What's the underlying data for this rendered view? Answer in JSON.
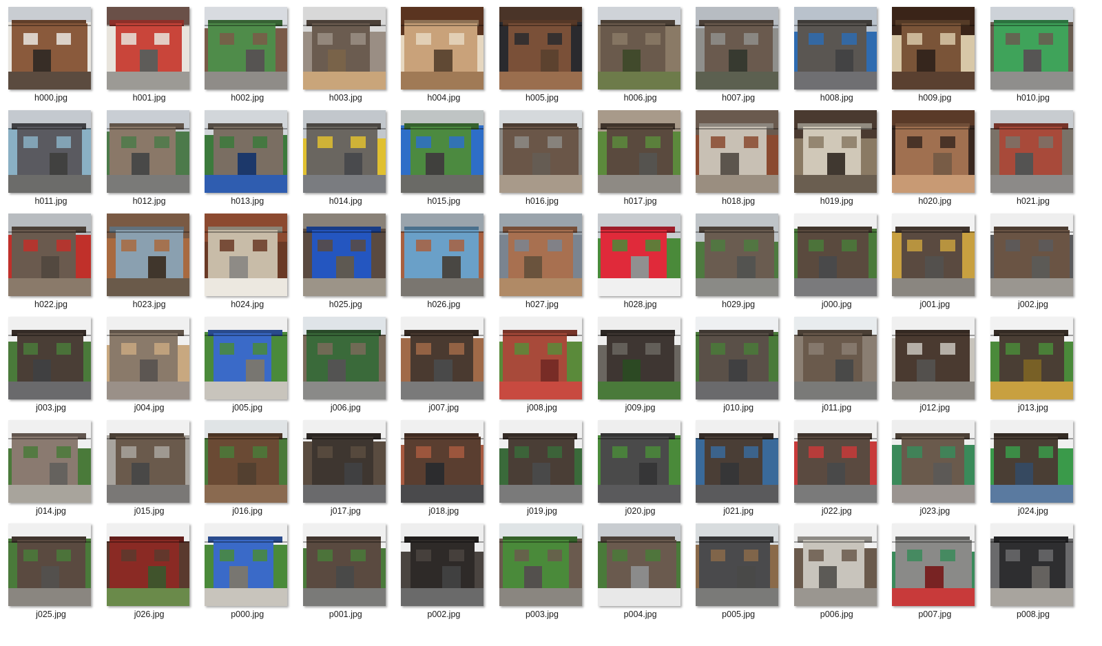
{
  "files": [
    {
      "name": "h000.jpg",
      "palette": [
        "#c9cdd2",
        "#8a5a3c",
        "#e9e6e0",
        "#5b4b3f"
      ]
    },
    {
      "name": "h001.jpg",
      "palette": [
        "#6a5048",
        "#c9453a",
        "#e8e4dc",
        "#9c9a95"
      ]
    },
    {
      "name": "h002.jpg",
      "palette": [
        "#d8dbe0",
        "#4f8c4a",
        "#7a5a48",
        "#8f8c88"
      ]
    },
    {
      "name": "h003.jpg",
      "palette": [
        "#d8d8d8",
        "#6b5c50",
        "#9a8e84",
        "#c9a57a"
      ]
    },
    {
      "name": "h004.jpg",
      "palette": [
        "#5a3420",
        "#c9a27a",
        "#e6d7c0",
        "#a07a56"
      ]
    },
    {
      "name": "h005.jpg",
      "palette": [
        "#4a3428",
        "#7a5038",
        "#2a2a2e",
        "#9a6e4e"
      ]
    },
    {
      "name": "h006.jpg",
      "palette": [
        "#cfd3d8",
        "#6a5a4c",
        "#8a7a66",
        "#6d7b4a"
      ]
    },
    {
      "name": "h007.jpg",
      "palette": [
        "#b7bcc2",
        "#6a5a4e",
        "#8f8f8c",
        "#5c6050"
      ]
    },
    {
      "name": "h008.jpg",
      "palette": [
        "#b9c2cc",
        "#5a5652",
        "#2e6bb0",
        "#6f6f72"
      ]
    },
    {
      "name": "h009.jpg",
      "palette": [
        "#3a2418",
        "#7a5438",
        "#d8c8a8",
        "#5a4030"
      ]
    },
    {
      "name": "h010.jpg",
      "palette": [
        "#cdd2d8",
        "#3fa35a",
        "#6a5c50",
        "#8f8e8c"
      ]
    },
    {
      "name": "h011.jpg",
      "palette": [
        "#c4c9cf",
        "#5a5a60",
        "#8ab0c4",
        "#6c6c6a"
      ]
    },
    {
      "name": "h012.jpg",
      "palette": [
        "#c9ced4",
        "#8a7868",
        "#4c7a4a",
        "#7a7a78"
      ]
    },
    {
      "name": "h013.jpg",
      "palette": [
        "#d2d6da",
        "#7a6e62",
        "#3c7a3c",
        "#2f5db0"
      ]
    },
    {
      "name": "h014.jpg",
      "palette": [
        "#c2c7cc",
        "#6a6660",
        "#e0c030",
        "#7a7c80"
      ]
    },
    {
      "name": "h015.jpg",
      "palette": [
        "#bfc4c4",
        "#4c8a40",
        "#2e6ec8",
        "#6a6a66"
      ]
    },
    {
      "name": "h016.jpg",
      "palette": [
        "#d5d9dc",
        "#6a5648",
        "#8c8a86",
        "#a89a8a"
      ]
    },
    {
      "name": "h017.jpg",
      "palette": [
        "#a89a8a",
        "#5a4a3e",
        "#5c8a3c",
        "#8e8a84"
      ]
    },
    {
      "name": "h018.jpg",
      "palette": [
        "#6a5a4e",
        "#c8c0b4",
        "#8a4a30",
        "#9a8e80"
      ]
    },
    {
      "name": "h019.jpg",
      "palette": [
        "#4a3a30",
        "#d0c8b8",
        "#8a7a64",
        "#6a5e50"
      ]
    },
    {
      "name": "h020.jpg",
      "palette": [
        "#5a3a28",
        "#a07050",
        "#3a2820",
        "#c89a74"
      ]
    },
    {
      "name": "h021.jpg",
      "palette": [
        "#c8ccd0",
        "#a84a3a",
        "#7a7268",
        "#8c8a88"
      ]
    },
    {
      "name": "h022.jpg",
      "palette": [
        "#b8bcc0",
        "#6a5a4e",
        "#c0302a",
        "#8a7a6a"
      ]
    },
    {
      "name": "h023.jpg",
      "palette": [
        "#7a5a44",
        "#8aa0b0",
        "#a86a40",
        "#6a5a4a"
      ]
    },
    {
      "name": "h024.jpg",
      "palette": [
        "#8c4a30",
        "#c8bca8",
        "#6a3a26",
        "#ece8e0"
      ]
    },
    {
      "name": "h025.jpg",
      "palette": [
        "#8a8278",
        "#2456c0",
        "#5a4a40",
        "#9c9488"
      ]
    },
    {
      "name": "h026.jpg",
      "palette": [
        "#9aa4ac",
        "#6aa0c8",
        "#a86040",
        "#7a7670"
      ]
    },
    {
      "name": "h027.jpg",
      "palette": [
        "#9aa4ac",
        "#a87050",
        "#7a8490",
        "#b08a66"
      ]
    },
    {
      "name": "h028.jpg",
      "palette": [
        "#c8ccd0",
        "#e02a3a",
        "#4a8a3a",
        "#f0f0f0"
      ]
    },
    {
      "name": "h029.jpg",
      "palette": [
        "#bfc4c8",
        "#6a5c50",
        "#4e7a40",
        "#8a8a86"
      ]
    },
    {
      "name": "j000.jpg",
      "palette": [
        "#f0f0f0",
        "#5a4a3e",
        "#4a7a3a",
        "#7a7a7c"
      ]
    },
    {
      "name": "j001.jpg",
      "palette": [
        "#f2f2f2",
        "#5a4a40",
        "#c8a040",
        "#8a8680"
      ]
    },
    {
      "name": "j002.jpg",
      "palette": [
        "#eeeeee",
        "#6a5444",
        "#5a5a5c",
        "#9a9690"
      ]
    },
    {
      "name": "j003.jpg",
      "palette": [
        "#f0f0f0",
        "#4a3e36",
        "#4a7a3a",
        "#6a6a6c"
      ]
    },
    {
      "name": "j004.jpg",
      "palette": [
        "#f0f0f0",
        "#8a7a6a",
        "#c8a880",
        "#9a9088"
      ]
    },
    {
      "name": "j005.jpg",
      "palette": [
        "#f0f0f0",
        "#3a6ac8",
        "#4a8a3a",
        "#c8c4bc"
      ]
    },
    {
      "name": "j006.jpg",
      "palette": [
        "#dfe4e8",
        "#3a6a3a",
        "#7a6a5a",
        "#8a8a88"
      ]
    },
    {
      "name": "j007.jpg",
      "palette": [
        "#f0f0f0",
        "#4a3a30",
        "#a06a48",
        "#7a7a7a"
      ]
    },
    {
      "name": "j008.jpg",
      "palette": [
        "#f0f0f0",
        "#a84a3a",
        "#5a8a3a",
        "#c84a40"
      ]
    },
    {
      "name": "j009.jpg",
      "palette": [
        "#eeeeee",
        "#3e3632",
        "#6a6660",
        "#4a7a3a"
      ]
    },
    {
      "name": "j010.jpg",
      "palette": [
        "#eef0f2",
        "#5a5048",
        "#4a7a3a",
        "#6a6a6c"
      ]
    },
    {
      "name": "j011.jpg",
      "palette": [
        "#e8ecee",
        "#6a5a4c",
        "#8a7e72",
        "#7a7a78"
      ]
    },
    {
      "name": "j012.jpg",
      "palette": [
        "#f0f0f0",
        "#4a3a30",
        "#c8c4bc",
        "#8a8680"
      ]
    },
    {
      "name": "j013.jpg",
      "palette": [
        "#f2f2f2",
        "#4a3e34",
        "#4a8a3a",
        "#c8a040"
      ]
    },
    {
      "name": "j014.jpg",
      "palette": [
        "#f0f0f0",
        "#8a7a70",
        "#4a7a3a",
        "#a8a49c"
      ]
    },
    {
      "name": "j015.jpg",
      "palette": [
        "#f0f0f0",
        "#6a5a4c",
        "#a8a49e",
        "#7a7876"
      ]
    },
    {
      "name": "j016.jpg",
      "palette": [
        "#e0e4e6",
        "#6a4a34",
        "#4a7a3a",
        "#8a6a50"
      ]
    },
    {
      "name": "j017.jpg",
      "palette": [
        "#f0f0f0",
        "#3e3630",
        "#5a4c40",
        "#6a6a6c"
      ]
    },
    {
      "name": "j018.jpg",
      "palette": [
        "#f0f0f0",
        "#5a3e30",
        "#a85a40",
        "#4a4a4c"
      ]
    },
    {
      "name": "j019.jpg",
      "palette": [
        "#f0f0f0",
        "#4a3e36",
        "#3a6a3a",
        "#7a7a7a"
      ]
    },
    {
      "name": "j020.jpg",
      "palette": [
        "#eeeeee",
        "#4a4a4a",
        "#4a8a3a",
        "#5a5a5c"
      ]
    },
    {
      "name": "j021.jpg",
      "palette": [
        "#f0f0f0",
        "#4a3e36",
        "#3a6a9a",
        "#5a5a5c"
      ]
    },
    {
      "name": "j022.jpg",
      "palette": [
        "#f0f0f0",
        "#5a4a40",
        "#c83a3a",
        "#7a7a7a"
      ]
    },
    {
      "name": "j023.jpg",
      "palette": [
        "#eeeeee",
        "#6a5a4c",
        "#3a8a5a",
        "#9a9490"
      ]
    },
    {
      "name": "j024.jpg",
      "palette": [
        "#f0f0f0",
        "#4a3e34",
        "#3a9a4a",
        "#5a7aa0"
      ]
    },
    {
      "name": "j025.jpg",
      "palette": [
        "#f0f0f0",
        "#5a4a40",
        "#4a7a3a",
        "#8a8680"
      ]
    },
    {
      "name": "j026.jpg",
      "palette": [
        "#f0f0f0",
        "#8a2a24",
        "#5a3a2e",
        "#6a8a4a"
      ]
    },
    {
      "name": "p000.jpg",
      "palette": [
        "#f0f0f0",
        "#3a6ac8",
        "#4a8a3a",
        "#c8c4bc"
      ]
    },
    {
      "name": "p001.jpg",
      "palette": [
        "#f0f0f0",
        "#5a4a40",
        "#4a7a3a",
        "#7a7a78"
      ]
    },
    {
      "name": "p002.jpg",
      "palette": [
        "#eeeeee",
        "#2e2a28",
        "#4a4440",
        "#6a6a6a"
      ]
    },
    {
      "name": "p003.jpg",
      "palette": [
        "#dfe4e6",
        "#4a8a3a",
        "#6a5a4e",
        "#8a8680"
      ]
    },
    {
      "name": "p004.jpg",
      "palette": [
        "#c8ccd0",
        "#6a5a4e",
        "#4a7a3a",
        "#e8e8e8"
      ]
    },
    {
      "name": "p005.jpg",
      "palette": [
        "#d8dcde",
        "#4a4a4c",
        "#8a6a4a",
        "#7a7a78"
      ]
    },
    {
      "name": "p006.jpg",
      "palette": [
        "#f0f0f0",
        "#c8c4bc",
        "#6a5a4c",
        "#9a9690"
      ]
    },
    {
      "name": "p007.jpg",
      "palette": [
        "#f0f0f0",
        "#8a8a88",
        "#3a8a5a",
        "#c83a3a"
      ]
    },
    {
      "name": "p008.jpg",
      "palette": [
        "#f0f0f0",
        "#2e2e30",
        "#6a6a6c",
        "#a8a49e"
      ]
    }
  ]
}
